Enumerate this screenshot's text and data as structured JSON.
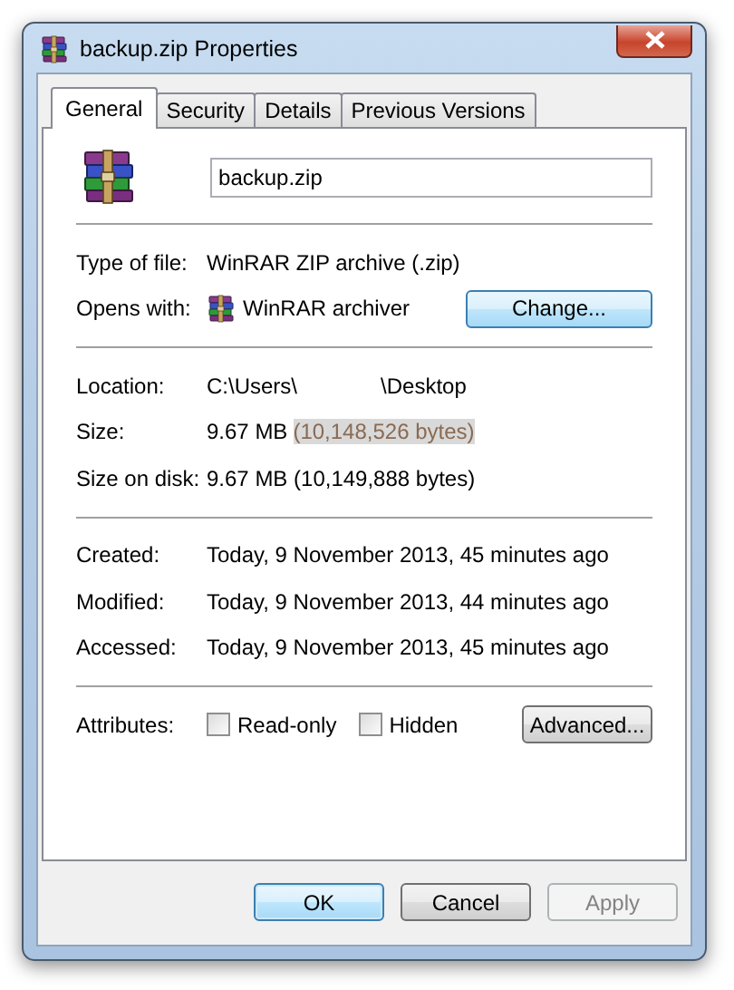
{
  "window": {
    "title": "backup.zip Properties"
  },
  "tabs": [
    {
      "label": "General",
      "selected": true
    },
    {
      "label": "Security",
      "selected": false
    },
    {
      "label": "Details",
      "selected": false
    },
    {
      "label": "Previous Versions",
      "selected": false
    }
  ],
  "file_name": {
    "value": "backup.zip"
  },
  "sections": [
    [
      {
        "kind": "text",
        "label": "Type of file:",
        "value": "WinRAR ZIP archive (.zip)"
      },
      {
        "kind": "app",
        "label": "Opens with:",
        "value": "WinRAR archiver",
        "button": "Change..."
      }
    ],
    [
      {
        "kind": "path",
        "label": "Location:",
        "value": "C:\\Users\\",
        "value_end": "\\Desktop"
      },
      {
        "kind": "size",
        "label": "Size:",
        "value": "9.67 MB",
        "highlight": "(10,148,526 bytes)"
      },
      {
        "kind": "text",
        "label": "Size on disk:",
        "value": "9.67 MB (10,149,888 bytes)"
      }
    ],
    [
      {
        "kind": "text",
        "label": "Created:",
        "value": "Today, 9 November 2013, 45 minutes ago"
      },
      {
        "kind": "text",
        "label": "Modified:",
        "value": "Today, 9 November 2013, 44 minutes ago"
      },
      {
        "kind": "text",
        "label": "Accessed:",
        "value": "Today, 9 November 2013, 45 minutes ago"
      }
    ],
    [
      {
        "kind": "attributes",
        "label": "Attributes:",
        "checkboxes": [
          {
            "label": "Read-only",
            "checked": false
          },
          {
            "label": "Hidden",
            "checked": false
          }
        ],
        "button": "Advanced..."
      }
    ]
  ],
  "buttons": [
    {
      "label": "OK",
      "default": true,
      "disabled": false
    },
    {
      "label": "Cancel",
      "default": false,
      "disabled": false
    },
    {
      "label": "Apply",
      "default": false,
      "disabled": true
    }
  ]
}
